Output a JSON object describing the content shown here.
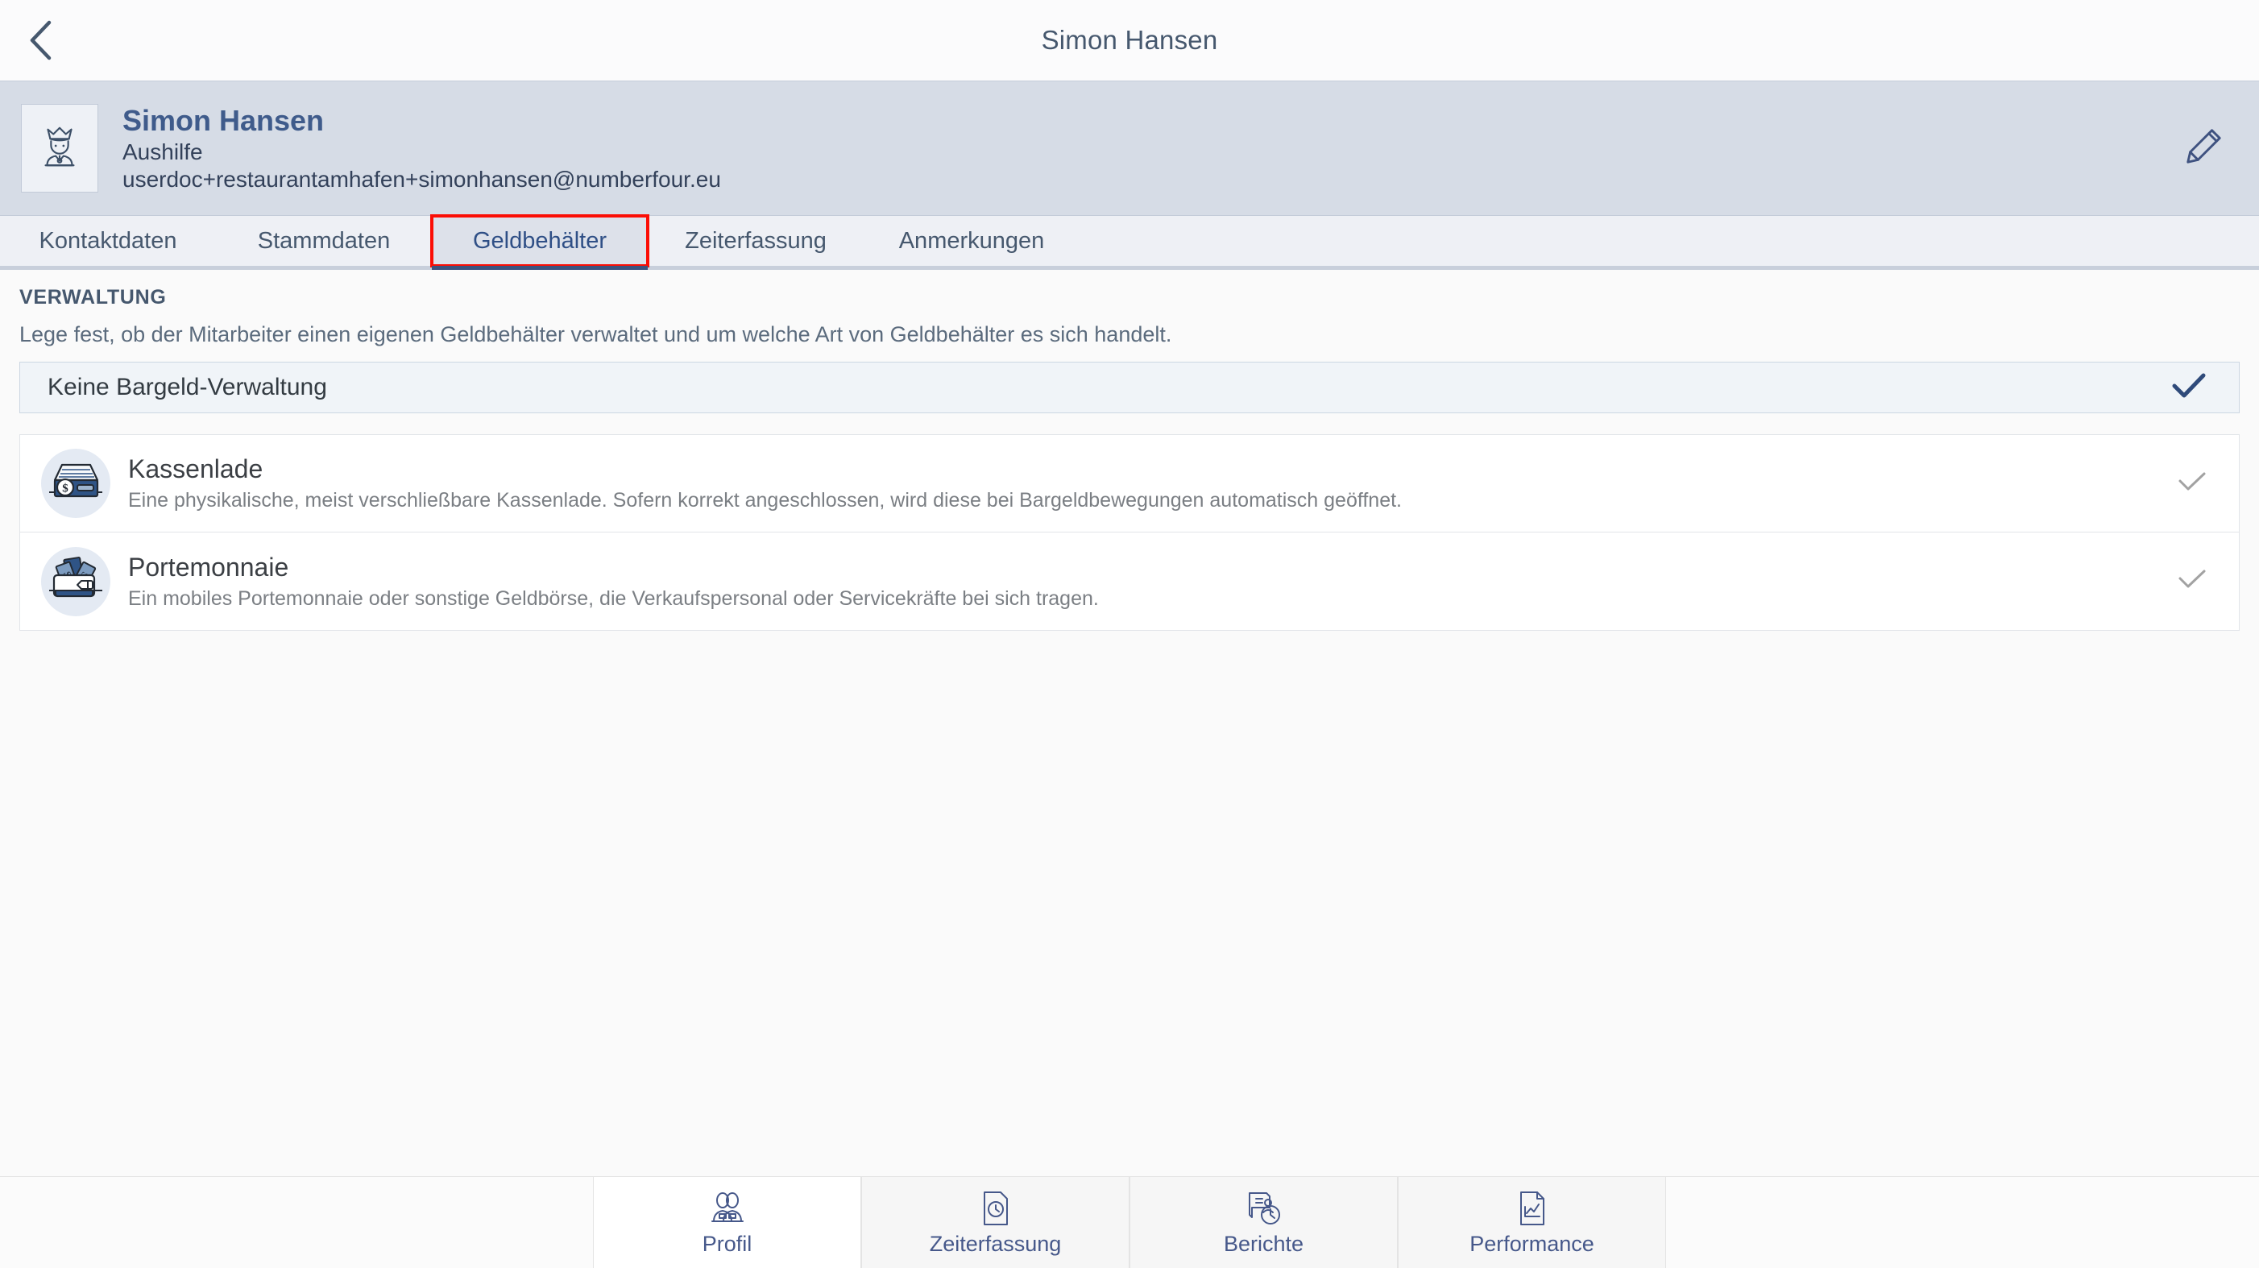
{
  "titlebar": {
    "back_icon": "chevron-left-icon",
    "title": "Simon Hansen"
  },
  "profile": {
    "avatar_icon": "person-crown-icon",
    "name": "Simon Hansen",
    "role": "Aushilfe",
    "email": "userdoc+restaurantamhafen+simonhansen@numberfour.eu",
    "edit_icon": "pencil-icon"
  },
  "tabs": [
    {
      "label": "Kontaktdaten",
      "active": false
    },
    {
      "label": "Stammdaten",
      "active": false
    },
    {
      "label": "Geldbehälter",
      "active": true,
      "highlighted": true
    },
    {
      "label": "Zeiterfassung",
      "active": false
    },
    {
      "label": "Anmerkungen",
      "active": false
    }
  ],
  "section": {
    "label": "VERWALTUNG",
    "description": "Lege fest, ob der Mitarbeiter einen eigenen Geldbehälter verwaltet und um welche Art von Geldbehälter es sich handelt."
  },
  "options": {
    "none": {
      "title": "Keine Bargeld-Verwaltung",
      "selected": true,
      "check_icon": "check-icon"
    },
    "items": [
      {
        "icon": "cash-drawer-icon",
        "title": "Kassenlade",
        "description": "Eine physikalische, meist verschließbare Kassenlade. Sofern korrekt angeschlossen, wird diese bei Bargeldbewegungen automatisch geöffnet.",
        "selected": false,
        "check_icon": "check-icon"
      },
      {
        "icon": "wallet-icon",
        "title": "Portemonnaie",
        "description": "Ein mobiles Portemonnaie oder sonstige Geldbörse, die Verkaufspersonal oder Servicekräfte bei sich tragen.",
        "selected": false,
        "check_icon": "check-icon"
      }
    ]
  },
  "bottomnav": [
    {
      "label": "Profil",
      "icon": "two-people-icon",
      "active": true
    },
    {
      "label": "Zeiterfassung",
      "icon": "document-clock-icon",
      "active": false
    },
    {
      "label": "Berichte",
      "icon": "receipt-clock-icon",
      "active": false
    },
    {
      "label": "Performance",
      "icon": "document-chart-icon",
      "active": false
    }
  ],
  "colors": {
    "accent": "#3f5b8b",
    "highlight": "#fb0d05",
    "header_bg": "#d6dce6",
    "tab_active_bg": "#dde1ea"
  }
}
